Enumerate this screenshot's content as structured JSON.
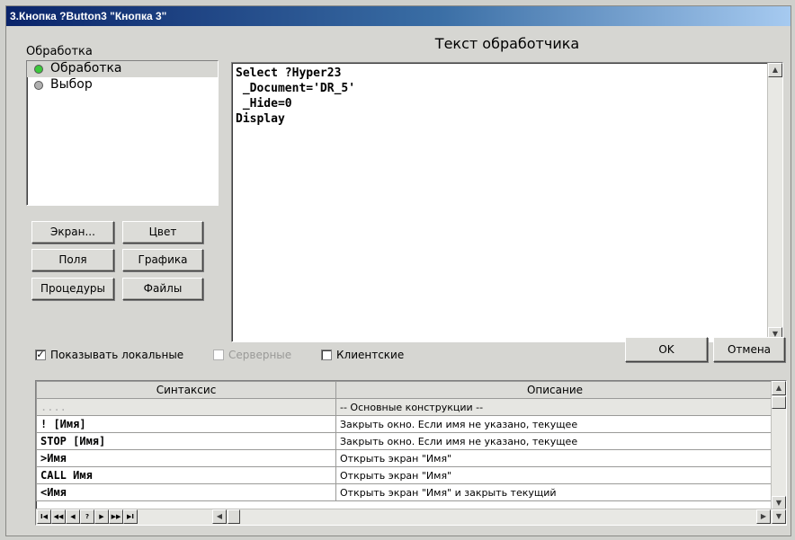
{
  "window": {
    "title": "3.Кнопка ?Button3 \"Кнопка 3\""
  },
  "events": {
    "label": "Обработка",
    "items": [
      {
        "label": "Обработка",
        "dot_color": "#3cc83c"
      },
      {
        "label": "Выбор",
        "dot_color": "#b0b0b0"
      }
    ]
  },
  "tool_buttons": {
    "screen": "Экран...",
    "color": "Цвет",
    "fields": "Поля",
    "graphics": "Графика",
    "procedures": "Процедуры",
    "files": "Файлы"
  },
  "handler": {
    "title": "Текст обработчика",
    "code": "Select ?Hyper23\n _Document='DR_5'\n _Hide=0\nDisplay"
  },
  "options": {
    "show_local": {
      "label": "Показывать локальные",
      "checked": true
    },
    "server": {
      "label": "Серверные",
      "checked": false,
      "disabled": true
    },
    "client": {
      "label": "Клиентские",
      "checked": false
    }
  },
  "dialog": {
    "ok": "OK",
    "cancel": "Отмена"
  },
  "syntax_table": {
    "headers": {
      "syntax": "Синтаксис",
      "description": "Описание"
    },
    "rows": [
      {
        "syntax": "....",
        "description": "-- Основные конструкции --"
      },
      {
        "syntax": "! [Имя]",
        "description": "Закрыть окно. Если имя не указано, текущее"
      },
      {
        "syntax": "STOP [Имя]",
        "description": "Закрыть окно. Если имя не указано, текущее"
      },
      {
        "syntax": ">Имя",
        "description": "Открыть экран \"Имя\""
      },
      {
        "syntax": "CALL Имя",
        "description": "Открыть экран \"Имя\""
      },
      {
        "syntax": "<Имя",
        "description": "Открыть экран \"Имя\" и закрыть текущий"
      }
    ]
  },
  "navigator": {
    "first": "I◀",
    "prev_page": "◀◀",
    "prev": "◀",
    "help": "?",
    "next": "▶",
    "next_page": "▶▶",
    "last": "▶I"
  }
}
